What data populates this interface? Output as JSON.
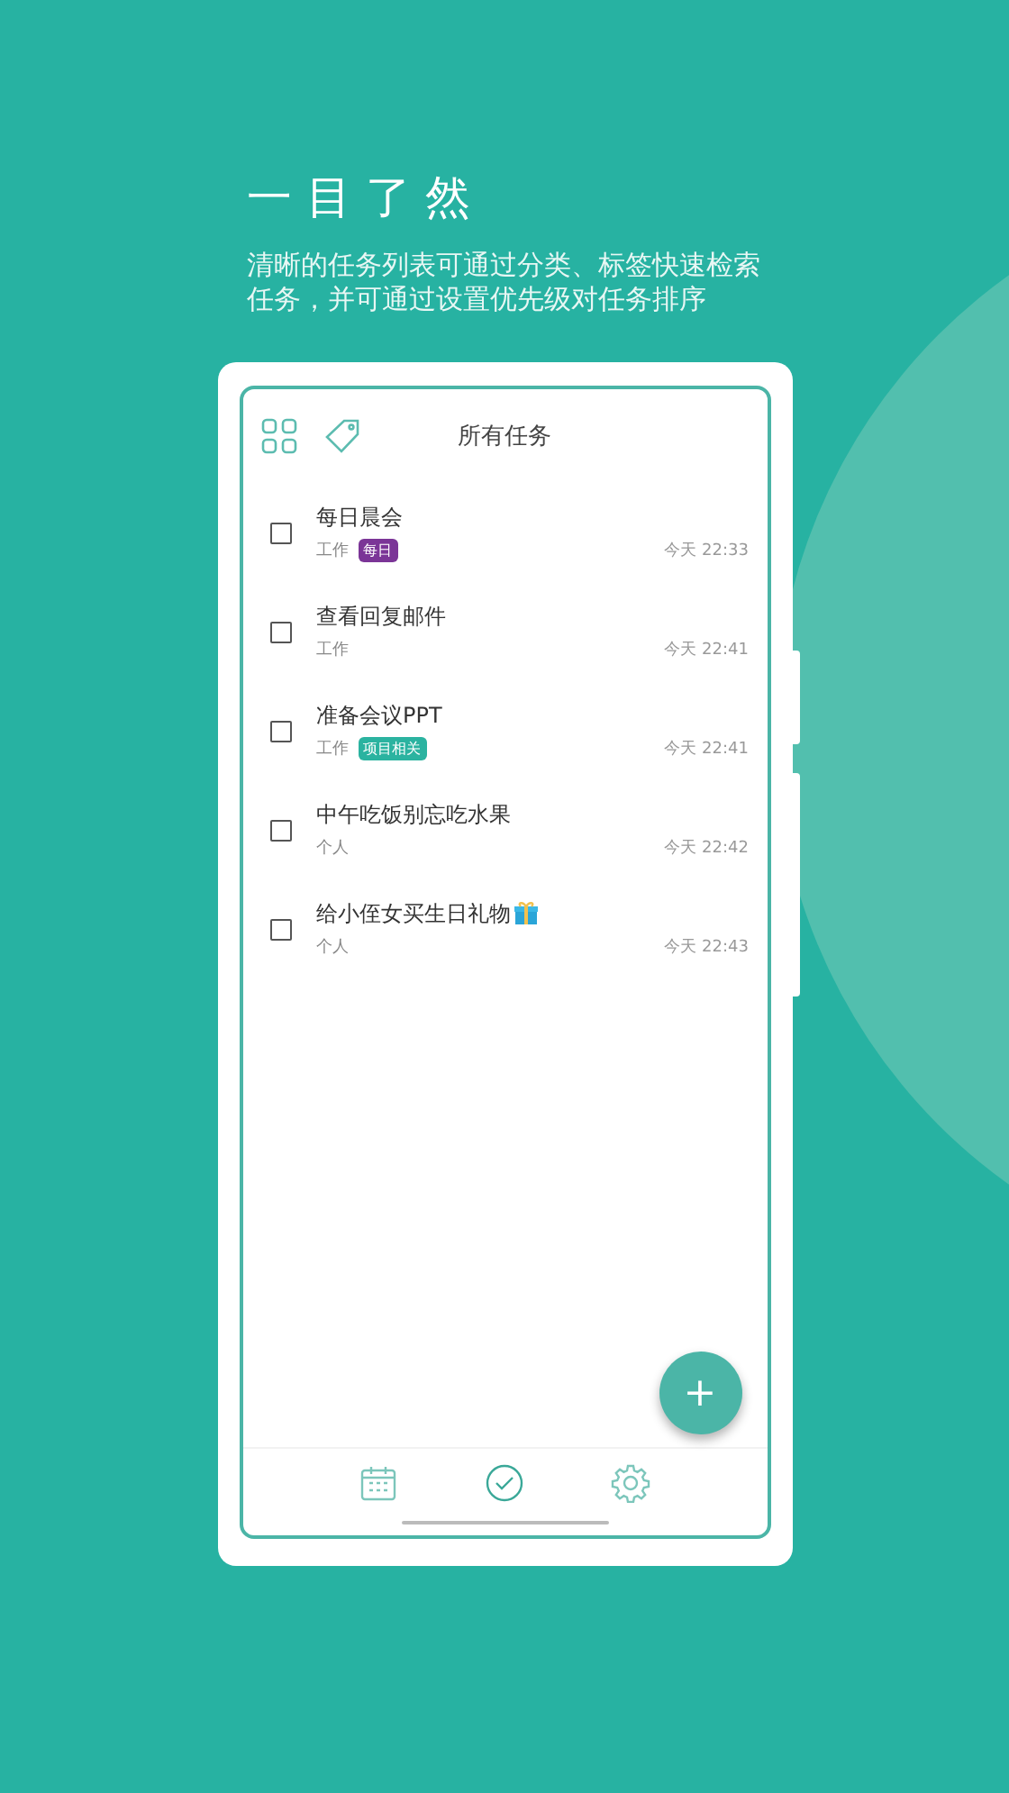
{
  "heading": "一目了然",
  "subtitle": "清晰的任务列表可通过分类、标签快速检索任务，并可通过设置优先级对任务排序",
  "app": {
    "title": "所有任务",
    "tasks": [
      {
        "title": "每日晨会",
        "category": "工作",
        "tag": {
          "label": "每日",
          "color": "#7b3597"
        },
        "time": "今天 22:33",
        "checked": false
      },
      {
        "title": "查看回复邮件",
        "category": "工作",
        "time": "今天 22:41",
        "checked": false
      },
      {
        "title": "准备会议PPT",
        "category": "工作",
        "tag": {
          "label": "项目相关",
          "color": "#2bb3a0"
        },
        "time": "今天 22:41",
        "checked": false
      },
      {
        "title": "中午吃饭别忘吃水果",
        "category": "个人",
        "time": "今天 22:42",
        "checked": false
      },
      {
        "title": "给小侄女买生日礼物",
        "has_icon": true,
        "category": "个人",
        "time": "今天 22:43",
        "checked": false
      }
    ],
    "fab": "+",
    "bottom_nav": [
      {
        "kind": "calendar",
        "selected": false
      },
      {
        "kind": "tasks",
        "selected": true
      },
      {
        "kind": "settings",
        "selected": false
      }
    ]
  }
}
